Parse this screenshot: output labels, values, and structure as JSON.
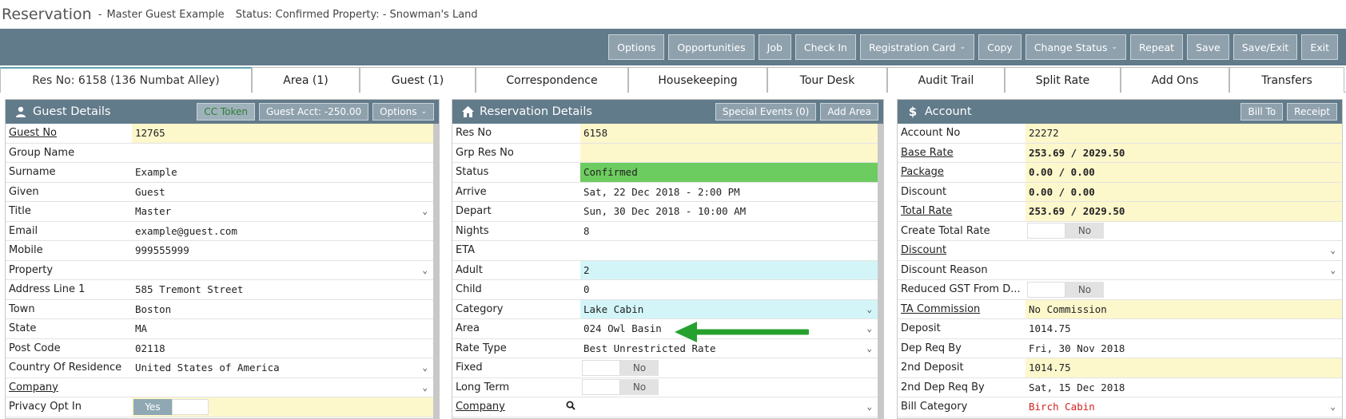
{
  "header": {
    "title": "Reservation",
    "dash": "-",
    "guest": "Master Guest Example",
    "status": "Status: Confirmed",
    "property": "Property: - Snowman's Land"
  },
  "toolbar": {
    "buttons": [
      "Options",
      "Opportunities",
      "Job",
      "Check In",
      "Registration Card",
      "Copy",
      "Change Status",
      "Repeat",
      "Save",
      "Save/Exit",
      "Exit"
    ]
  },
  "tabs": [
    "Res No: 6158 (136 Numbat Alley)",
    "Area (1)",
    "Guest (1)",
    "Correspondence",
    "Housekeeping",
    "Tour Desk",
    "Audit Trail",
    "Split Rate",
    "Add Ons",
    "Transfers"
  ],
  "guest_panel": {
    "title": "Guest Details",
    "btn_cc": "CC Token",
    "btn_acct": "Guest Acct: -250.00",
    "btn_options": "Options",
    "rows": [
      {
        "label": "Guest No",
        "value": "12765"
      },
      {
        "label": "Group Name",
        "value": ""
      },
      {
        "label": "Surname",
        "value": "Example"
      },
      {
        "label": "Given",
        "value": "Guest"
      },
      {
        "label": "Title",
        "value": "Master"
      },
      {
        "label": "Email",
        "value": "example@guest.com"
      },
      {
        "label": "Mobile",
        "value": "999555999"
      },
      {
        "label": "Property",
        "value": ""
      },
      {
        "label": "Address Line 1",
        "value": "585 Tremont Street"
      },
      {
        "label": "Town",
        "value": "Boston"
      },
      {
        "label": "State",
        "value": "MA"
      },
      {
        "label": "Post Code",
        "value": "02118"
      },
      {
        "label": "Country Of Residence",
        "value": "United States of America"
      },
      {
        "label": "Company",
        "value": ""
      },
      {
        "label": "Privacy Opt In",
        "value": "Yes"
      }
    ]
  },
  "res_panel": {
    "title": "Reservation Details",
    "btn_events": "Special Events (0)",
    "btn_add_area": "Add Area",
    "rows": [
      {
        "label": "Res No",
        "value": "6158"
      },
      {
        "label": "Grp Res No",
        "value": ""
      },
      {
        "label": "Status",
        "value": "Confirmed"
      },
      {
        "label": "Arrive",
        "value": "Sat, 22 Dec 2018 - 2:00 PM"
      },
      {
        "label": "Depart",
        "value": "Sun, 30 Dec 2018 - 10:00 AM"
      },
      {
        "label": "Nights",
        "value": "8"
      },
      {
        "label": "ETA",
        "value": ""
      },
      {
        "label": "Adult",
        "value": "2"
      },
      {
        "label": "Child",
        "value": "0"
      },
      {
        "label": "Category",
        "value": "Lake Cabin"
      },
      {
        "label": "Area",
        "value": "024 Owl Basin"
      },
      {
        "label": "Rate Type",
        "value": "Best Unrestricted Rate"
      },
      {
        "label": "Fixed",
        "value": "No"
      },
      {
        "label": "Long Term",
        "value": "No"
      },
      {
        "label": "Company",
        "value": ""
      }
    ]
  },
  "acct_panel": {
    "title": "Account",
    "btn_bill_to": "Bill To",
    "btn_receipt": "Receipt",
    "rows": [
      {
        "label": "Account No",
        "value": "22272"
      },
      {
        "label": "Base Rate",
        "value": "253.69 / 2029.50"
      },
      {
        "label": "Package",
        "value": "0.00 / 0.00"
      },
      {
        "label": "Discount",
        "value": "0.00 / 0.00"
      },
      {
        "label": "Total Rate",
        "value": "253.69 / 2029.50"
      },
      {
        "label": "Create Total Rate",
        "value": "No"
      },
      {
        "label": "Discount",
        "value": ""
      },
      {
        "label": "Discount Reason",
        "value": ""
      },
      {
        "label": "Reduced GST From D...",
        "value": "No"
      },
      {
        "label": "TA Commission",
        "value": "No Commission"
      },
      {
        "label": "Deposit",
        "value": "1014.75"
      },
      {
        "label": "Dep Req By",
        "value": "Fri, 30 Nov 2018"
      },
      {
        "label": "2nd Deposit",
        "value": "1014.75"
      },
      {
        "label": "2nd Dep Req By",
        "value": "Sat, 15 Dec 2018"
      },
      {
        "label": "Bill Category",
        "value": "Birch Cabin"
      }
    ]
  },
  "colors": {
    "toolbar": "#627b8a",
    "button": "#8fa1ad",
    "yellow": "#fdf7cc",
    "green_status": "#6dcc5f",
    "cyan": "#d3f5f8",
    "arrow": "#27a12e",
    "red_text": "#d62020"
  },
  "icons": {
    "guest": "user-icon",
    "reservation": "home-icon",
    "account": "dollar-icon",
    "dropdown": "chevron-down-icon",
    "search": "search-icon",
    "annotation": "arrow-left-icon"
  }
}
